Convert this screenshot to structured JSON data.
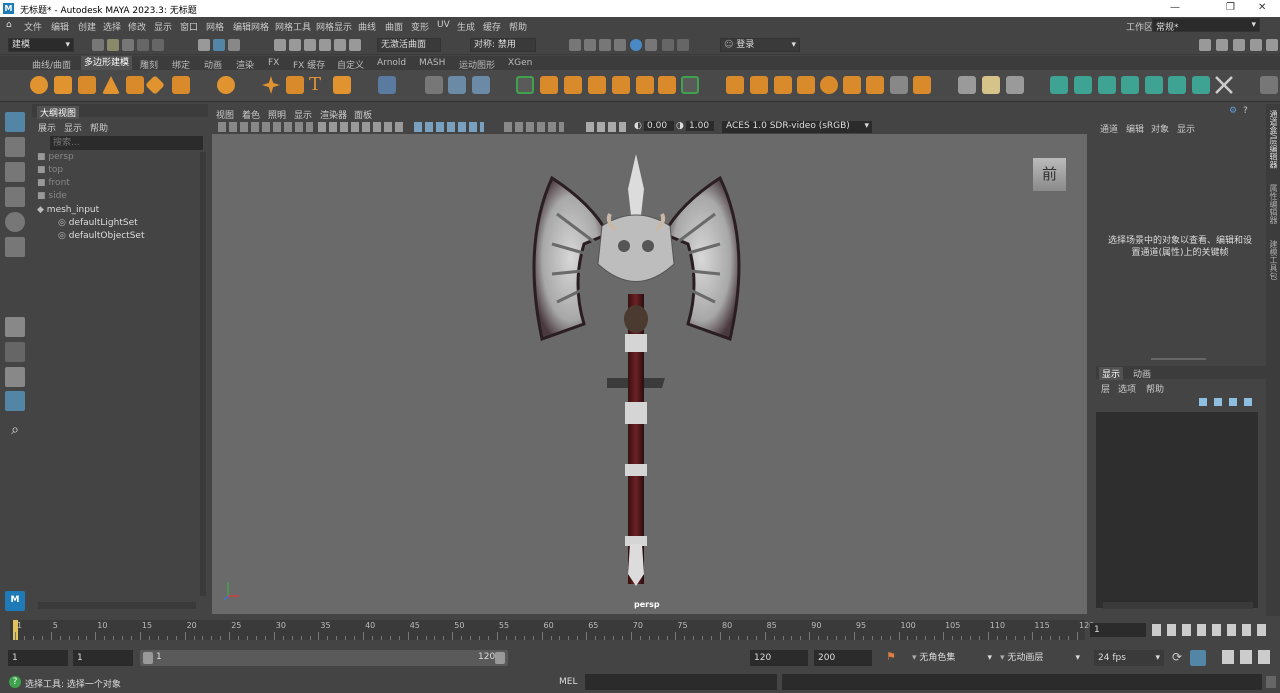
{
  "window": {
    "title": "无标题* - Autodesk MAYA 2023.3: 无标题",
    "controls": [
      "—",
      "❐",
      "✕"
    ]
  },
  "menubar": {
    "items": [
      "文件",
      "编辑",
      "创建",
      "选择",
      "修改",
      "显示",
      "窗口",
      "网格",
      "编辑网格",
      "网格工具",
      "网格显示",
      "曲线",
      "曲面",
      "变形",
      "UV",
      "生成",
      "缓存",
      "帮助"
    ],
    "workspace_label": "工作区:",
    "workspace_value": "常规*"
  },
  "statusline": {
    "mode": "建模",
    "live_surface": "无激活曲面",
    "symmetry": "对称: 禁用",
    "login": "登录"
  },
  "shelf": {
    "tabs": [
      "曲线/曲面",
      "多边形建模",
      "雕刻",
      "绑定",
      "动画",
      "渲染",
      "FX",
      "FX 缓存",
      "自定义",
      "Arnold",
      "MASH",
      "运动图形",
      "XGen"
    ],
    "active_tab": "多边形建模"
  },
  "outliner": {
    "title": "大纲视图",
    "menu": [
      "展示",
      "显示",
      "帮助"
    ],
    "search_placeholder": "搜索...",
    "items": [
      {
        "label": "persp",
        "kind": "camera"
      },
      {
        "label": "top",
        "kind": "camera"
      },
      {
        "label": "front",
        "kind": "camera"
      },
      {
        "label": "side",
        "kind": "camera"
      },
      {
        "label": "mesh_input",
        "kind": "mesh"
      },
      {
        "label": "defaultLightSet",
        "kind": "set"
      },
      {
        "label": "defaultObjectSet",
        "kind": "set"
      }
    ]
  },
  "viewport": {
    "menu": [
      "视图",
      "着色",
      "照明",
      "显示",
      "渲染器",
      "面板"
    ],
    "exposure": "0.00",
    "gamma": "1.00",
    "colorspace": "ACES 1.0 SDR-video (sRGB)",
    "camera_label": "persp",
    "viewcube_label": "前"
  },
  "channelbox": {
    "menu": [
      "通道",
      "编辑",
      "对象",
      "显示"
    ],
    "hint": "选择场景中的对象以查看、编辑和设置通道(属性)上的关键帧"
  },
  "layers": {
    "tabs": [
      "显示",
      "动画"
    ],
    "menu": [
      "层",
      "选项",
      "帮助"
    ]
  },
  "sidetabs": [
    "通道盒/层编辑器",
    "属性编辑器",
    "建模工具包"
  ],
  "timeline": {
    "ticks": [
      "1",
      "5",
      "10",
      "15",
      "20",
      "25",
      "30",
      "35",
      "40",
      "45",
      "50",
      "55",
      "60",
      "65",
      "70",
      "75",
      "80",
      "85",
      "90",
      "95",
      "100",
      "105",
      "110",
      "115",
      "120"
    ],
    "current_frame": "1"
  },
  "range": {
    "start": "1",
    "start_inner": "1",
    "slider_start": "1",
    "slider_end": "120",
    "end_inner": "120",
    "end": "200",
    "character_set": "无角色集",
    "anim_layer": "无动画层",
    "fps": "24 fps"
  },
  "cmdline": {
    "help": "选择工具: 选择一个对象",
    "lang": "MEL"
  },
  "colors": {
    "accent": "#5d9fd6",
    "active_tool": "#5285a6",
    "timeline_current": "#e2c25a"
  }
}
